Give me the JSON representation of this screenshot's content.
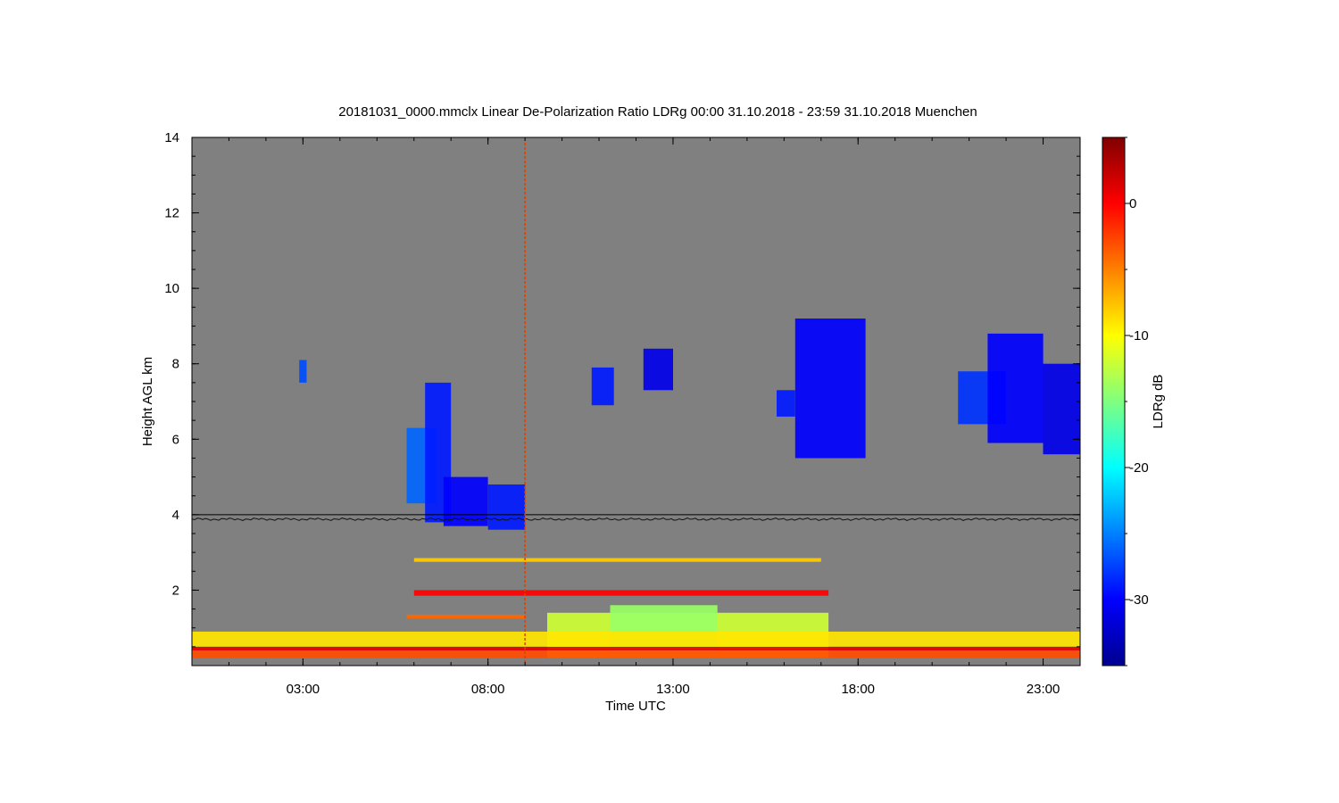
{
  "chart_data": {
    "type": "heatmap",
    "title": "20181031_0000.mmclx Linear De-Polarization Ratio LDRg   00:00 31.10.2018 - 23:59 31.10.2018 Muenchen",
    "xlabel": "Time UTC",
    "ylabel": "Height AGL km",
    "colorbar_label": "LDRg dB",
    "x_unit": "hours UTC",
    "xlim": [
      0,
      24
    ],
    "ylim": [
      0,
      14
    ],
    "clim": [
      -35,
      5
    ],
    "x_ticks": [
      {
        "value": 3,
        "label": "03:00"
      },
      {
        "value": 8,
        "label": "08:00"
      },
      {
        "value": 13,
        "label": "13:00"
      },
      {
        "value": 18,
        "label": "18:00"
      },
      {
        "value": 23,
        "label": "23:00"
      }
    ],
    "y_ticks": [
      {
        "value": 2,
        "label": "2"
      },
      {
        "value": 4,
        "label": "4"
      },
      {
        "value": 6,
        "label": "6"
      },
      {
        "value": 8,
        "label": "8"
      },
      {
        "value": 10,
        "label": "10"
      },
      {
        "value": 12,
        "label": "12"
      },
      {
        "value": 14,
        "label": "14"
      }
    ],
    "colorbar_ticks": [
      {
        "value": 0,
        "label": "0"
      },
      {
        "value": -10,
        "label": "-10"
      },
      {
        "value": -20,
        "label": "-20"
      },
      {
        "value": -30,
        "label": "-30"
      }
    ],
    "colormap": [
      "#00008f",
      "#0000ff",
      "#0080ff",
      "#00ffff",
      "#80ff80",
      "#ffff00",
      "#ff8000",
      "#ff0000",
      "#800000"
    ],
    "background_color": "#808080",
    "reference_line_km": 4.0,
    "melting_layer_km": 3.88,
    "spike_time_h": 9.0,
    "regions": [
      {
        "t0": 2.9,
        "t1": 3.1,
        "h0": 7.5,
        "h1": 8.1,
        "ldr": -27
      },
      {
        "t0": 5.8,
        "t1": 6.6,
        "h0": 4.3,
        "h1": 6.3,
        "ldr": -26
      },
      {
        "t0": 6.3,
        "t1": 7.0,
        "h0": 3.8,
        "h1": 7.5,
        "ldr": -29
      },
      {
        "t0": 6.8,
        "t1": 8.0,
        "h0": 3.7,
        "h1": 5.0,
        "ldr": -30
      },
      {
        "t0": 8.0,
        "t1": 9.0,
        "h0": 3.6,
        "h1": 4.8,
        "ldr": -29
      },
      {
        "t0": 10.8,
        "t1": 11.4,
        "h0": 6.9,
        "h1": 7.9,
        "ldr": -29
      },
      {
        "t0": 12.2,
        "t1": 13.0,
        "h0": 7.3,
        "h1": 8.4,
        "ldr": -31
      },
      {
        "t0": 15.8,
        "t1": 16.3,
        "h0": 6.6,
        "h1": 7.3,
        "ldr": -29
      },
      {
        "t0": 16.3,
        "t1": 18.2,
        "h0": 5.5,
        "h1": 9.2,
        "ldr": -30
      },
      {
        "t0": 20.7,
        "t1": 22.0,
        "h0": 6.4,
        "h1": 7.8,
        "ldr": -28
      },
      {
        "t0": 21.5,
        "t1": 23.0,
        "h0": 5.9,
        "h1": 8.8,
        "ldr": -30
      },
      {
        "t0": 23.0,
        "t1": 24.0,
        "h0": 5.6,
        "h1": 8.0,
        "ldr": -31
      },
      {
        "t0": 9.6,
        "t1": 17.2,
        "h0": 0.2,
        "h1": 1.4,
        "ldr": -12
      },
      {
        "t0": 11.3,
        "t1": 14.2,
        "h0": 0.3,
        "h1": 1.6,
        "ldr": -14
      },
      {
        "t0": 0.0,
        "t1": 24.0,
        "h0": 0.4,
        "h1": 0.5,
        "ldr": 1
      },
      {
        "t0": 0.0,
        "t1": 24.0,
        "h0": 0.2,
        "h1": 0.4,
        "ldr": -3
      },
      {
        "t0": 0.0,
        "t1": 24.0,
        "h0": 0.5,
        "h1": 0.9,
        "ldr": -9
      },
      {
        "t0": 6.0,
        "t1": 17.2,
        "h0": 1.85,
        "h1": 2.0,
        "ldr": 0
      },
      {
        "t0": 6.0,
        "t1": 17.0,
        "h0": 2.75,
        "h1": 2.85,
        "ldr": -8
      },
      {
        "t0": 5.8,
        "t1": 9.0,
        "h0": 1.25,
        "h1": 1.35,
        "ldr": -4
      }
    ]
  }
}
